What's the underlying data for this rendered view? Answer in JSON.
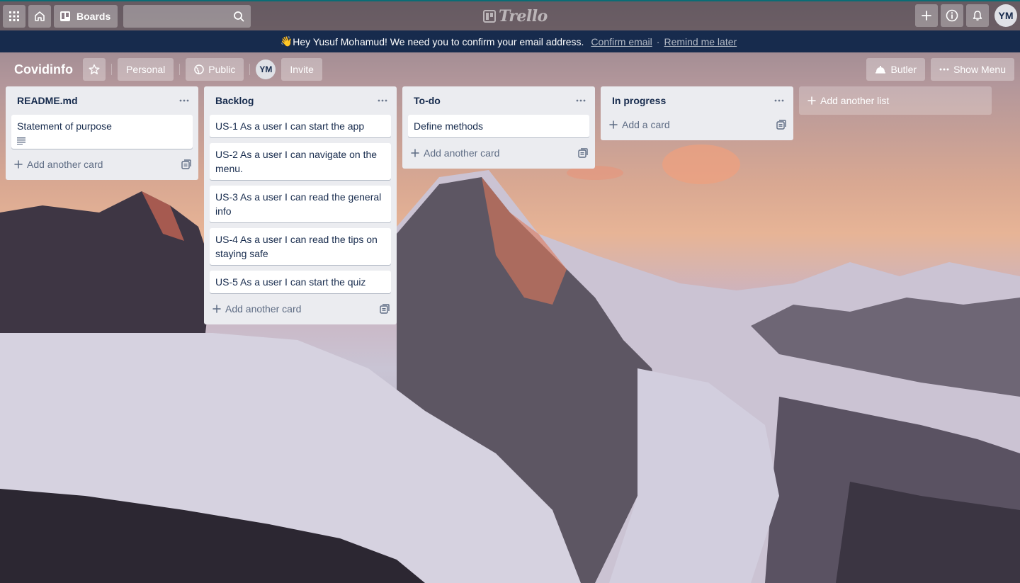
{
  "header": {
    "boards_label": "Boards",
    "search_value": "",
    "logo_text": "Trello",
    "avatar_initials": "YM"
  },
  "banner": {
    "emoji": "👋",
    "message": "Hey Yusuf Mohamud! We need you to confirm your email address.",
    "confirm_link": "Confirm email",
    "separator": "·",
    "remind_link": "Remind me later"
  },
  "board": {
    "title": "Covidinfo",
    "team_label": "Personal",
    "visibility_label": "Public",
    "member_initials": "YM",
    "invite_label": "Invite",
    "butler_label": "Butler",
    "show_menu_label": "Show Menu"
  },
  "lists": [
    {
      "title": "README.md",
      "cards": [
        {
          "title": "Statement of purpose",
          "has_description": true
        }
      ],
      "add_label": "Add another card"
    },
    {
      "title": "Backlog",
      "cards": [
        {
          "title": "US-1 As a user I can start the app"
        },
        {
          "title": "US-2 As a user I can navigate on the menu."
        },
        {
          "title": "US-3 As a user I can read the general info"
        },
        {
          "title": "US-4 As a user I can read the tips on staying safe"
        },
        {
          "title": "US-5 As a user I can start the quiz"
        }
      ],
      "add_label": "Add another card"
    },
    {
      "title": "To-do",
      "cards": [
        {
          "title": "Define methods"
        }
      ],
      "add_label": "Add another card"
    },
    {
      "title": "In progress",
      "cards": [],
      "add_label": "Add a card"
    }
  ],
  "add_list_label": "Add another list",
  "colors": {
    "header_accent": "#0a6c75",
    "banner_bg": "#172b4d",
    "list_bg": "#ebecf0"
  }
}
